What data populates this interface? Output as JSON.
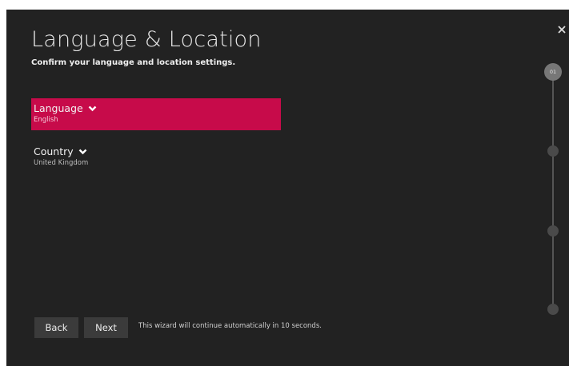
{
  "header": {
    "title": "Language & Location",
    "subtitle": "Confirm your language and location settings."
  },
  "settings": [
    {
      "label": "Language",
      "value": "English",
      "selected": true
    },
    {
      "label": "Country",
      "value": "United Kingdom",
      "selected": false
    }
  ],
  "footer": {
    "back_label": "Back",
    "next_label": "Next",
    "auto_message": "This wizard will continue automatically in 10 seconds."
  },
  "stepper": {
    "current_step": "01",
    "total_steps": 4
  },
  "icons": {
    "close": "close-icon",
    "chevron": "chevron-down-icon"
  },
  "colors": {
    "background": "#222222",
    "accent": "#c70b4a",
    "button": "#3b3b3b"
  }
}
